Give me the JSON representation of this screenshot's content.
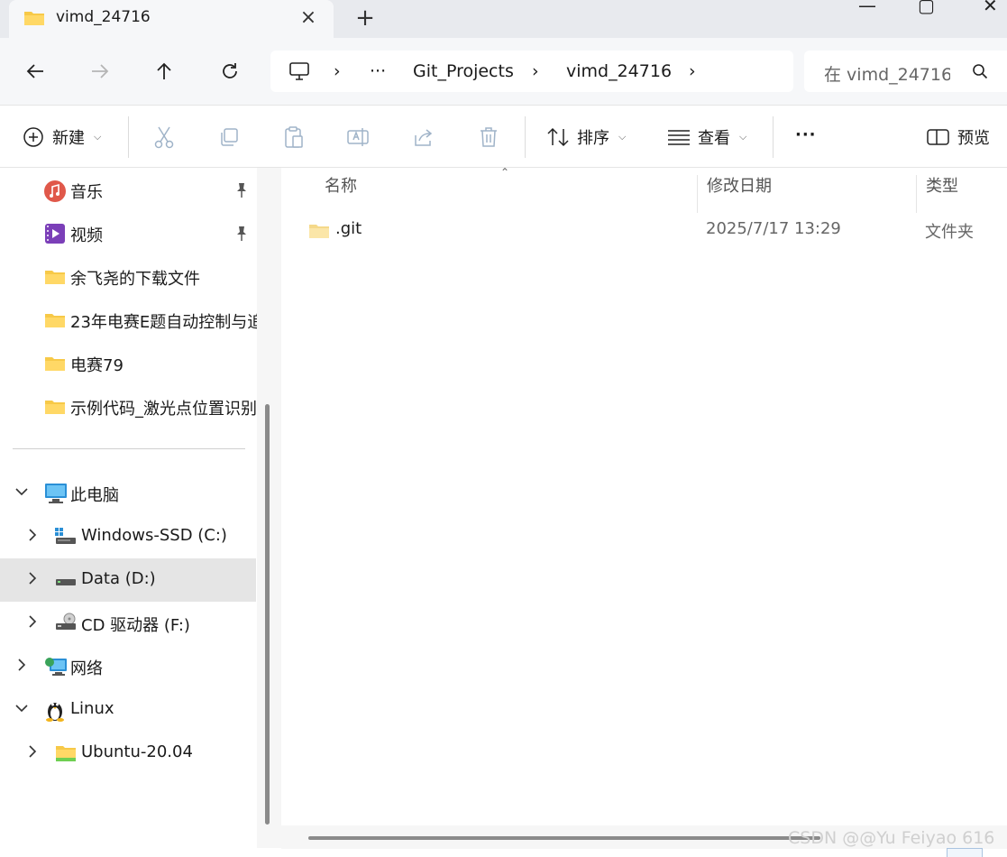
{
  "tab": {
    "title": "vimd_24716",
    "close_icon": "×",
    "new_tab_icon": "+"
  },
  "window_controls": {
    "minimize": "—",
    "maximize": "▢",
    "close": "✕"
  },
  "address": {
    "overflow": "···",
    "segments": [
      "Git_Projects",
      "vimd_24716"
    ],
    "separator": "›"
  },
  "search": {
    "placeholder": "在 vimd_24716 中搜索"
  },
  "toolbar": {
    "new_label": "新建",
    "sort_label": "排序",
    "view_label": "查看",
    "more_label": "···",
    "preview_label": "预览"
  },
  "sidebar": {
    "quick_access": [
      {
        "label": "音乐",
        "icon": "music-icon",
        "pinned": true
      },
      {
        "label": "视频",
        "icon": "video-icon",
        "pinned": true
      },
      {
        "label": "余飞尧的下载文件",
        "icon": "folder-icon"
      },
      {
        "label": "23年电赛E题自动控制与追",
        "icon": "folder-icon"
      },
      {
        "label": "电赛79",
        "icon": "folder-icon"
      },
      {
        "label": "示例代码_激光点位置识别",
        "icon": "folder-icon"
      }
    ],
    "this_pc": {
      "label": "此电脑",
      "expanded": true
    },
    "drives": [
      {
        "label": "Windows-SSD (C:)",
        "icon": "windows-drive-icon"
      },
      {
        "label": "Data (D:)",
        "icon": "drive-icon",
        "selected": true
      },
      {
        "label": "CD 驱动器 (F:)",
        "icon": "cd-drive-icon"
      }
    ],
    "network": {
      "label": "网络"
    },
    "linux": {
      "label": "Linux",
      "expanded": true
    },
    "linux_items": [
      {
        "label": "Ubuntu-20.04"
      }
    ]
  },
  "columns": {
    "name": "名称",
    "modified": "修改日期",
    "type": "类型"
  },
  "files": [
    {
      "name": ".git",
      "modified": "2025/7/17 13:29",
      "type": "文件夹"
    }
  ],
  "watermark": "CSDN @@Yu Feiyao 616",
  "colors": {
    "folder": "#f7c948",
    "selected": "#e5e5e5",
    "accent": "#0067c0"
  }
}
